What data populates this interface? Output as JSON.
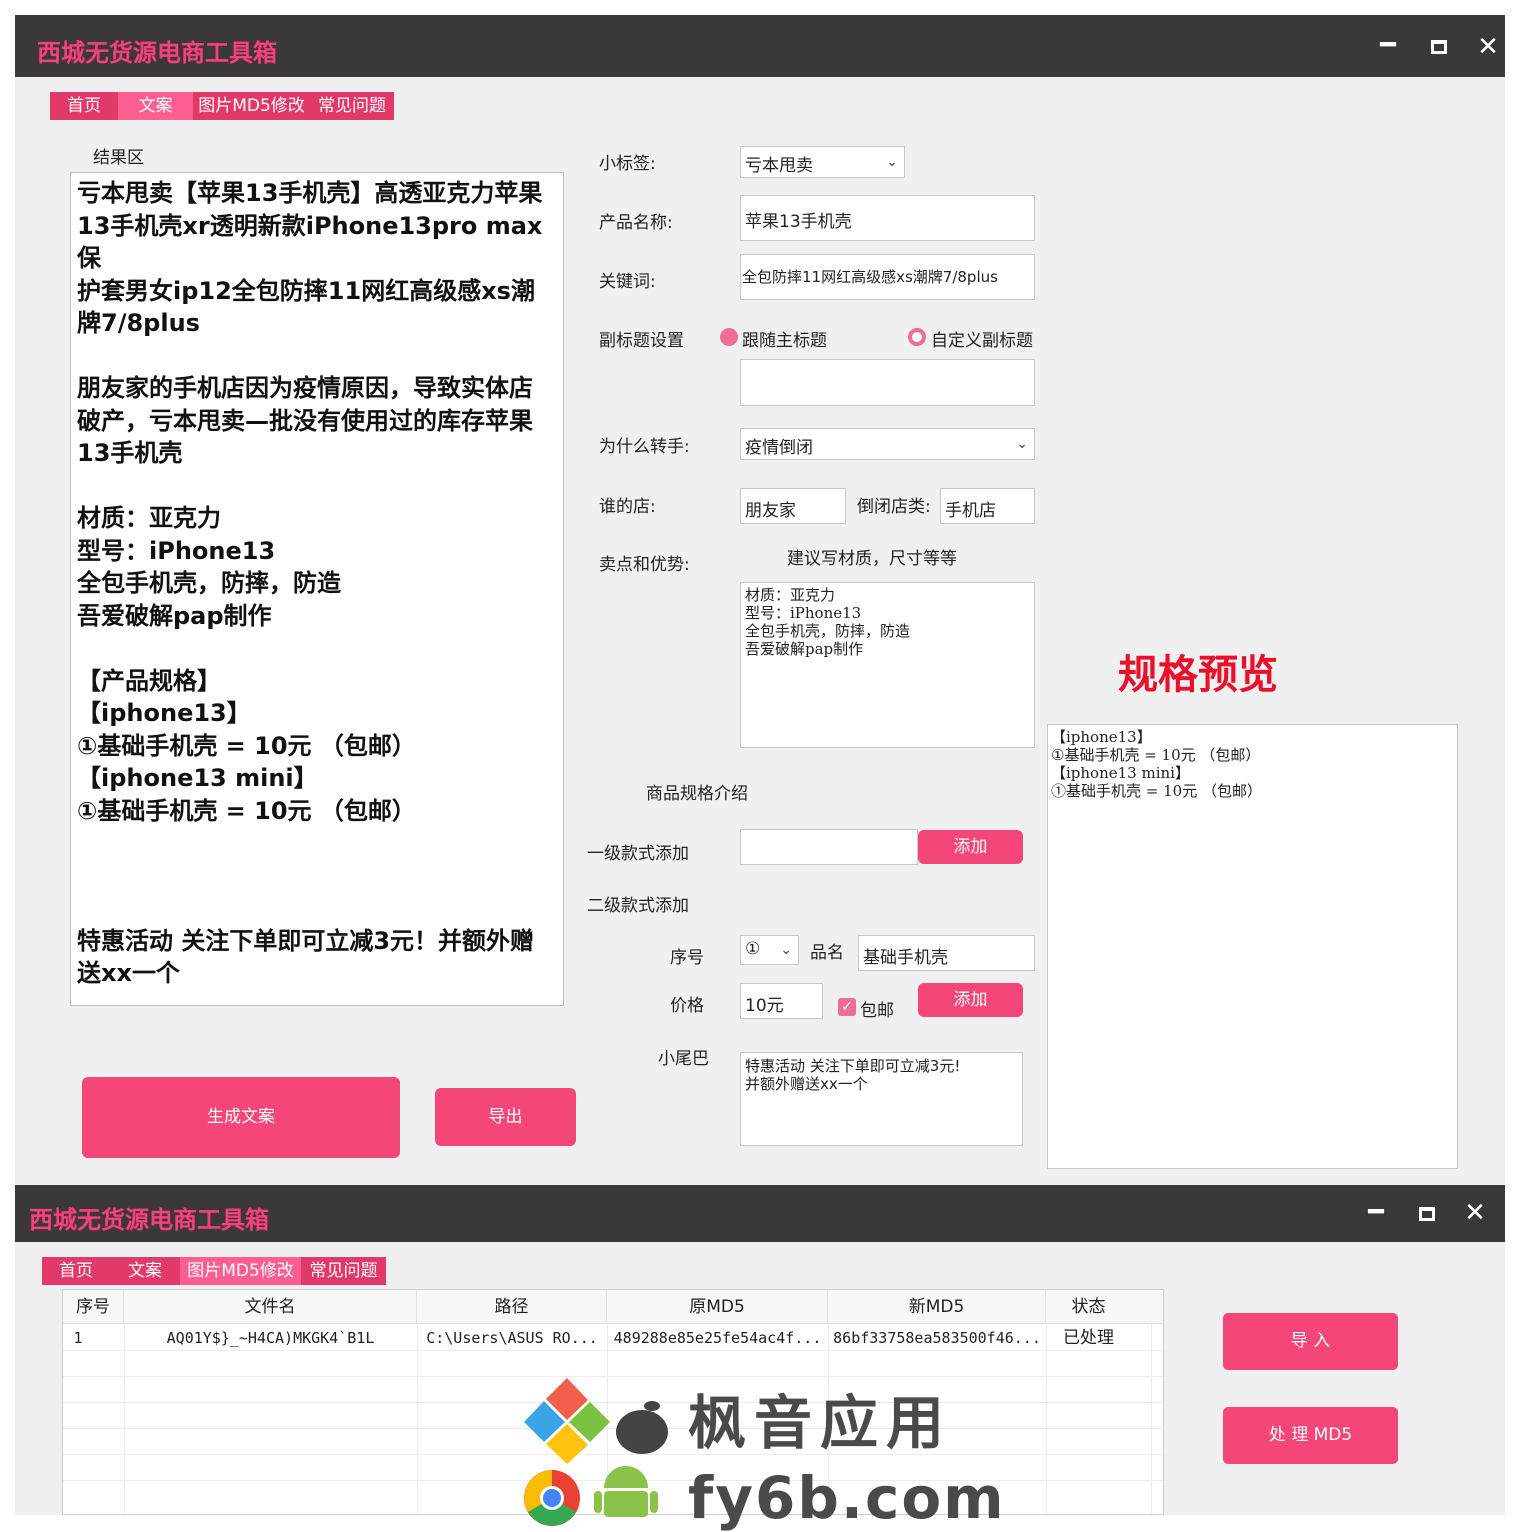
{
  "colors": {
    "accent": "#f44679",
    "titlebar": "#3a383c",
    "title_text": "#ff3d7f",
    "preview_title": "#e8102a"
  },
  "window1": {
    "title": "西城无货源电商工具箱",
    "controls": {
      "minimize": "━",
      "maximize": "■",
      "close": "✕"
    },
    "tabs": [
      "首页",
      "文案",
      "图片MD5修改",
      "常见问题"
    ],
    "result": {
      "label": "结果区",
      "text": "亏本甩卖【苹果13手机壳】高透亚克力苹果\n13手机壳xr透明新款iPhone13pro max保\n护套男女ip12全包防摔11网红高级感xs潮\n牌7/8plus\n\n朋友家的手机店因为疫情原因，导致实体店\n破产，亏本甩卖—批没有使用过的库存苹果\n13手机壳\n\n材质：亚克力\n型号：iPhone13\n全包手机壳，防摔，防造\n吾爱破解pap制作\n\n【产品规格】\n【iphone13】\n①基础手机壳 = 10元 （包邮）\n【iphone13 mini】\n①基础手机壳 = 10元 （包邮）\n\n\n\n特惠活动 关注下单即可立减3元！并额外赠\n送xx一个"
    },
    "buttons": {
      "generate": "生成文案",
      "export": "导出",
      "add_level1": "添加",
      "add_level2": "添加"
    },
    "form": {
      "tag_label": "小标签:",
      "tag_value": "亏本甩卖",
      "product_label": "产品名称:",
      "product_value": "苹果13手机壳",
      "keyword_label": "关键词:",
      "keyword_value": "全包防摔11网红高级感xs潮牌7/8plus",
      "subtitle_label": "副标题设置",
      "radio_follow": "跟随主标题",
      "radio_custom": "自定义副标题",
      "subtitle_value": "",
      "reason_label": "为什么转手:",
      "reason_value": "疫情倒闭",
      "whose_label": "谁的店:",
      "whose_value": "朋友家",
      "closed_label": "倒闭店类:",
      "closed_value": "手机店",
      "selling_label": "卖点和优势:",
      "selling_hint": "建议写材质，尺寸等等",
      "selling_value": "材质：亚克力\n型号：iPhone13\n全包手机壳，防摔，防造\n吾爱破解pap制作",
      "spec_intro_label": "商品规格介绍",
      "level1_label": "一级款式添加",
      "level1_value": "",
      "level2_label": "二级款式添加",
      "seq_label": "序号",
      "seq_value": "①",
      "name_label": "品名",
      "name_value": "基础手机壳",
      "price_label": "价格",
      "price_value": "10元",
      "free_ship_label": "包邮",
      "tail_label": "小尾巴",
      "tail_value": "特惠活动 关注下单即可立减3元!\n并额外赠送xx一个"
    },
    "preview": {
      "title": "规格预览",
      "text": "【iphone13】\n①基础手机壳 = 10元 （包邮）\n【iphone13 mini】\n①基础手机壳 = 10元 （包邮）"
    }
  },
  "window2": {
    "title": "西城无货源电商工具箱",
    "controls": {
      "minimize": "━",
      "maximize": "■",
      "close": "✕"
    },
    "tabs": [
      "首页",
      "文案",
      "图片MD5修改",
      "常见问题"
    ],
    "table": {
      "headers": [
        "序号",
        "文件名",
        "路径",
        "原MD5",
        "新MD5",
        "状态"
      ],
      "rows": [
        [
          "1",
          "AQ01Y$}_~H4CA)MKGK4`B1L",
          "C:\\Users\\ASUS RO...",
          "489288e85e25fe54ac4f...",
          "86bf33758ea583500f46...",
          "已处理"
        ]
      ]
    },
    "buttons": {
      "import": "导 入",
      "process": "处 理 MD5"
    }
  },
  "watermark": {
    "line1": "枫音应用",
    "line2": "fy6b.com"
  }
}
